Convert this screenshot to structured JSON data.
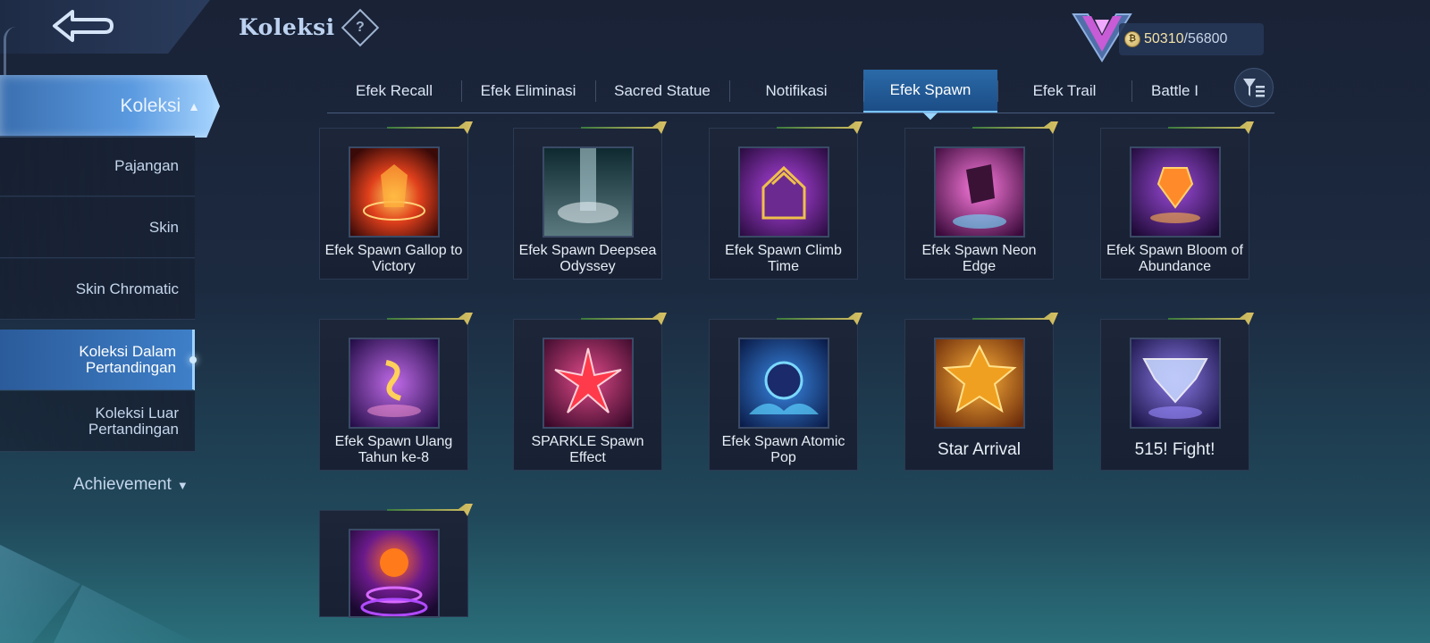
{
  "header": {
    "title": "Koleksi",
    "help_glyph": "?",
    "currency": {
      "value": "50310",
      "separator": "/",
      "max": "56800",
      "icon": "coin-icon"
    }
  },
  "sidebar": {
    "active_section": "Koleksi",
    "items": [
      {
        "label": "Pajangan"
      },
      {
        "label": "Skin"
      },
      {
        "label": "Skin Chromatic"
      },
      {
        "label": "Koleksi Dalam Pertandingan"
      },
      {
        "label": "Koleksi Luar Pertandingan"
      }
    ],
    "selected_item": "Koleksi Dalam Pertandingan",
    "achievement_label": "Achievement"
  },
  "tabs": {
    "items": [
      {
        "label": "Efek Recall"
      },
      {
        "label": "Efek Eliminasi"
      },
      {
        "label": "Sacred Statue"
      },
      {
        "label": "Notifikasi"
      },
      {
        "label": "Efek Spawn"
      },
      {
        "label": "Efek Trail"
      },
      {
        "label": "Battle I"
      }
    ],
    "active": "Efek Spawn"
  },
  "items": [
    {
      "name": "Efek Spawn Gallop to Victory",
      "theme": "red-gold"
    },
    {
      "name": "Efek Spawn Deepsea Odyssey",
      "theme": "teal-dark"
    },
    {
      "name": "Efek Spawn Climb Time",
      "theme": "purple-gold"
    },
    {
      "name": "Efek Spawn Neon Edge",
      "theme": "magenta"
    },
    {
      "name": "Efek Spawn Bloom of Abundance",
      "theme": "purple-orange"
    },
    {
      "name": "Efek Spawn Ulang Tahun ke-8",
      "theme": "violet-gold"
    },
    {
      "name": "SPARKLE Spawn Effect",
      "theme": "pink-red"
    },
    {
      "name": "Efek Spawn Atomic Pop",
      "theme": "blue-cyan"
    },
    {
      "name": "Star Arrival",
      "theme": "orange-goal"
    },
    {
      "name": "515! Fight!",
      "theme": "blue-violet"
    },
    {
      "name": "",
      "theme": "halloween"
    }
  ],
  "colors": {
    "accent": "#5b9ae0",
    "active_tab": "#2a6aa8",
    "gold": "#d4b14a",
    "currency": "#f3e2a6"
  }
}
